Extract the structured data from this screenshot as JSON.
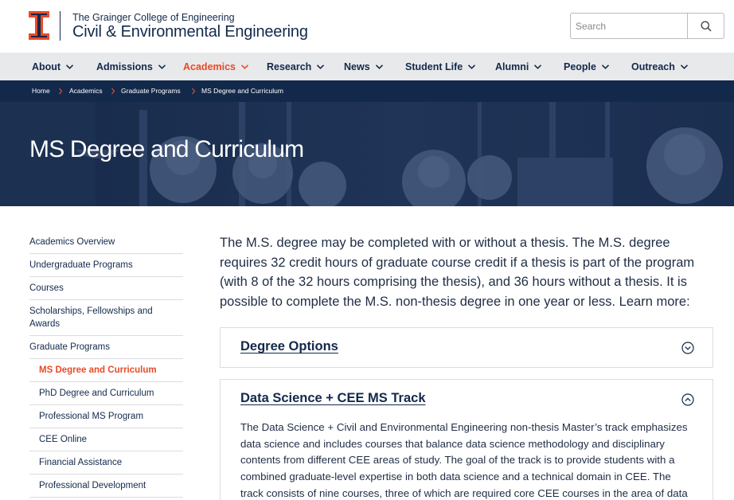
{
  "header": {
    "college": "The Grainger College of Engineering",
    "department": "Civil & Environmental Engineering",
    "logo_icon": "illinois-block-i-logo",
    "brand_color": "#e84a27",
    "navy_color": "#13294b"
  },
  "search": {
    "placeholder": "Search",
    "button_icon": "search-icon"
  },
  "nav": {
    "items": [
      {
        "label": "About"
      },
      {
        "label": "Admissions"
      },
      {
        "label": "Academics",
        "active": true
      },
      {
        "label": "Research"
      },
      {
        "label": "News"
      },
      {
        "label": "Student Life"
      },
      {
        "label": "Alumni"
      },
      {
        "label": "People"
      },
      {
        "label": "Outreach"
      }
    ]
  },
  "breadcrumb": [
    "Home",
    "Academics",
    "Graduate Programs",
    "MS Degree and Curriculum"
  ],
  "hero": {
    "title": "MS Degree and Curriculum"
  },
  "sidebar": {
    "items": [
      {
        "label": "Academics Overview"
      },
      {
        "label": "Undergraduate Programs"
      },
      {
        "label": "Courses"
      },
      {
        "label": "Scholarships, Fellowships and Awards"
      },
      {
        "label": "Graduate Programs"
      },
      {
        "label": "MS Degree and Curriculum",
        "current": true
      },
      {
        "label": "PhD Degree and Curriculum"
      },
      {
        "label": "Professional MS Program"
      },
      {
        "label": "CEE Online"
      },
      {
        "label": "Financial Assistance"
      },
      {
        "label": "Professional Development"
      }
    ]
  },
  "main": {
    "intro": "The M.S. degree may be completed with or without a thesis. The M.S. degree requires 32 credit hours of graduate course credit if a thesis is part of the program (with 8 of the 32 hours comprising the thesis), and 36 hours without a thesis. It is possible to complete the M.S. non-thesis degree in one year or less. Learn more:",
    "accordions": [
      {
        "title": "Degree Options",
        "expanded": false,
        "toggle_icon": "chevron-down-circle-icon"
      },
      {
        "title": "Data Science + CEE MS Track",
        "expanded": true,
        "toggle_icon": "chevron-up-circle-icon",
        "body": "The Data Science + Civil and Environmental Engineering non-thesis Master’s track emphasizes data science and includes courses that balance data science methodology and disciplinary contents from different CEE areas of study. The goal of the track is to provide students with a combined graduate-level expertise in both data science and a technical domain in CEE. The track consists of nine courses, three of which are required core CEE courses in the area of data science."
      }
    ]
  }
}
